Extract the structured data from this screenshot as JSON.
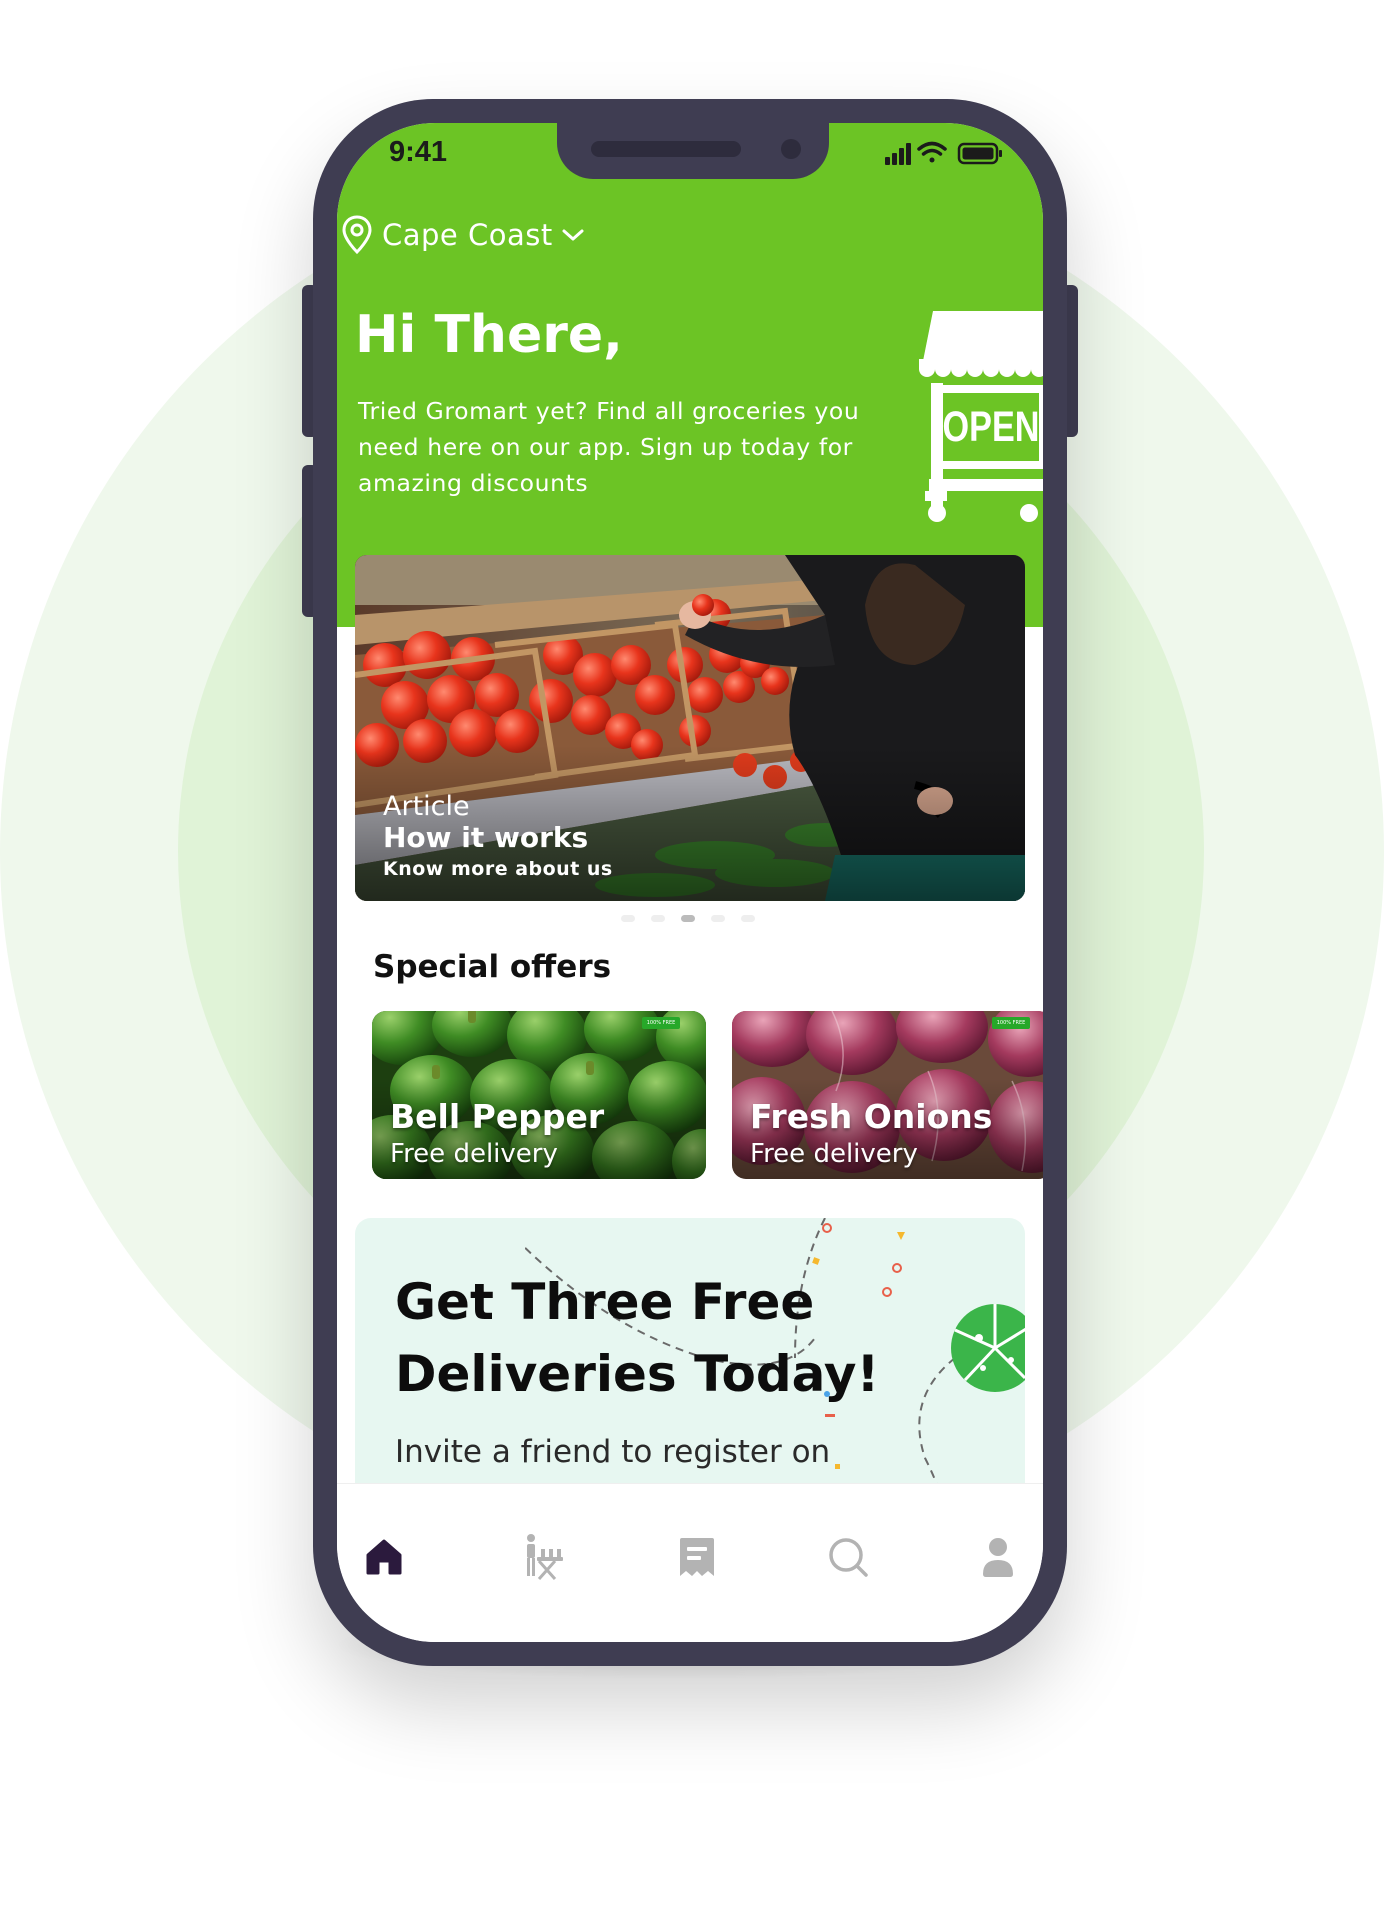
{
  "status_bar": {
    "time": "9:41"
  },
  "location": {
    "name": "Cape Coast"
  },
  "hero": {
    "title": "Hi There,",
    "subtitle": "Tried Gromart yet? Find all groceries you need here on our app. Sign up today for amazing discounts",
    "sign_text": "OPEN"
  },
  "banner": {
    "label": "Article",
    "title": "How it works",
    "subtitle": "Know more about us",
    "pagination": {
      "count": 5,
      "active": 3
    }
  },
  "special_offers": {
    "title": "Special offers",
    "items": [
      {
        "title": "Bell Pepper",
        "subtitle": "Free delivery",
        "tag": "100% FREE"
      },
      {
        "title": "Fresh Onions",
        "subtitle": "Free delivery",
        "tag": "100% FREE"
      }
    ]
  },
  "promo": {
    "headline_line1": "Get Three Free",
    "headline_line2": "Deliveries Today!",
    "body": "Invite a friend to register on"
  },
  "tab_bar": {
    "tabs": [
      {
        "icon": "home-icon",
        "active": true
      },
      {
        "icon": "shopping-icon",
        "active": false
      },
      {
        "icon": "receipt-icon",
        "active": false
      },
      {
        "icon": "search-icon",
        "active": false
      },
      {
        "icon": "profile-icon",
        "active": false
      }
    ]
  },
  "colors": {
    "brand_green": "#6cc425",
    "tag_green": "#27a829",
    "active_tab": "#2b1a3d",
    "inactive_tab": "#b3b3b3",
    "phone_frame": "#3f3d52"
  }
}
